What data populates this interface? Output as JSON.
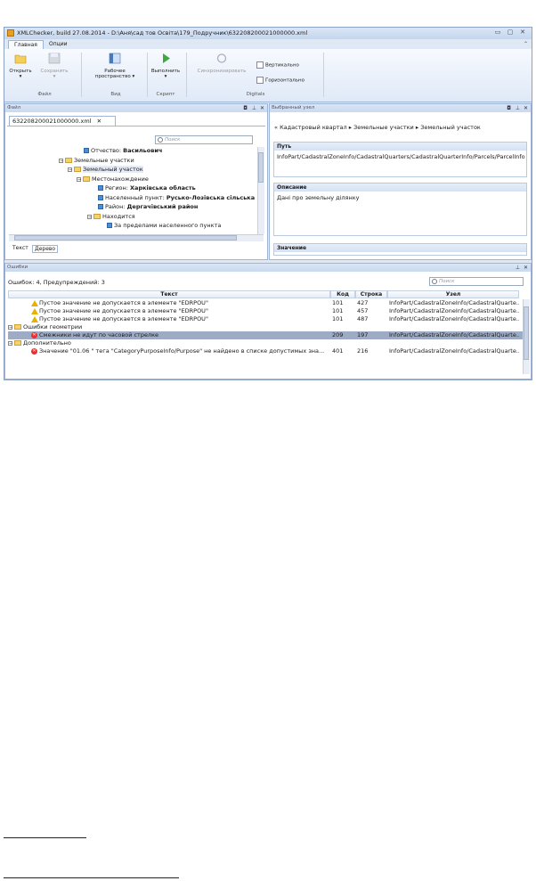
{
  "window": {
    "title": "XMLChecker, build 27.08.2014 - D:\\Аня\\сад тов Освіта\\179_Подручник\\632208200021000000.xml"
  },
  "ribbon": {
    "tabs": [
      "Главная",
      "Опции"
    ],
    "buttons": {
      "open": "Открыть",
      "save": "Сохранить",
      "workspace_1": "Рабочее",
      "workspace_2": "пространство",
      "run": "Выполнить",
      "sync": "Синхронизировать",
      "vertical": "Вертикально",
      "horizontal": "Горизонтально"
    },
    "groups": {
      "file": "Файл",
      "view": "Вид",
      "script": "Скрипт",
      "digitals": "Digitals"
    }
  },
  "file_panel": {
    "title": "Файл",
    "doc_tab": "632208200021000000.xml",
    "search_placeholder": "Поиск",
    "tree": [
      {
        "label": "Отчество: ",
        "value": "Васильович"
      },
      {
        "label": "Земельные участки",
        "value": ""
      },
      {
        "label": "Земельный участок",
        "value": ""
      },
      {
        "label": "Местонахождение",
        "value": ""
      },
      {
        "label": "Регион: ",
        "value": "Харківська область"
      },
      {
        "label": "Населенный пункт: ",
        "value": "Русько-Лозівська сільська"
      },
      {
        "label": "Район: ",
        "value": "Дергачівський район"
      },
      {
        "label": "Находится",
        "value": ""
      },
      {
        "label": "За пределами населенного пункта",
        "value": ""
      }
    ],
    "bottom_tabs": [
      "Текст",
      "Дерево"
    ]
  },
  "node_panel": {
    "title": "Выбранный узел",
    "breadcrumb": [
      "Кадастровый квартал",
      "Земельные участки",
      "Земельный участок"
    ],
    "path_title": "Путь",
    "path_value": "InfoPart/CadastralZoneInfo/CadastralQuarters/CadastralQuarterInfo/Parcels/ParcelInfo",
    "description_title": "Описание",
    "description_value": "Дані про земельну ділянку",
    "value_title": "Значение"
  },
  "errors_panel": {
    "title": "Ошибки",
    "summary": "Ошибок: 4, Предупреждений: 3",
    "search_placeholder": "Поиск",
    "columns": [
      "Текст",
      "Код",
      "Строка",
      "Узел"
    ],
    "rows": [
      {
        "kind": "warning",
        "text": "Пустое значение не допускается в элементе \"EDRPOU\"",
        "code": "101",
        "line": "427",
        "node": "InfoPart/CadastralZoneInfo/CadastralQuarte..."
      },
      {
        "kind": "warning",
        "text": "Пустое значение не допускается в элементе \"EDRPOU\"",
        "code": "101",
        "line": "457",
        "node": "InfoPart/CadastralZoneInfo/CadastralQuarte..."
      },
      {
        "kind": "warning",
        "text": "Пустое значение не допускается в элементе \"EDRPOU\"",
        "code": "101",
        "line": "487",
        "node": "InfoPart/CadastralZoneInfo/CadastralQuarte..."
      },
      {
        "kind": "group",
        "text": "Ошибки геометрии",
        "code": "",
        "line": "",
        "node": ""
      },
      {
        "kind": "error",
        "text": "Смежники не идут по часовой стрелке",
        "code": "209",
        "line": "197",
        "node": "InfoPart/CadastralZoneInfo/CadastralQuarte..."
      },
      {
        "kind": "group",
        "text": "Дополнительно",
        "code": "",
        "line": "",
        "node": ""
      },
      {
        "kind": "error",
        "text": "Значение \"01.06 \" тега \"CategoryPurposeInfo/Purpose\" не найдено в списке допустимых зна...",
        "code": "401",
        "line": "216",
        "node": "InfoPart/CadastralZoneInfo/CadastralQuarte..."
      }
    ]
  }
}
